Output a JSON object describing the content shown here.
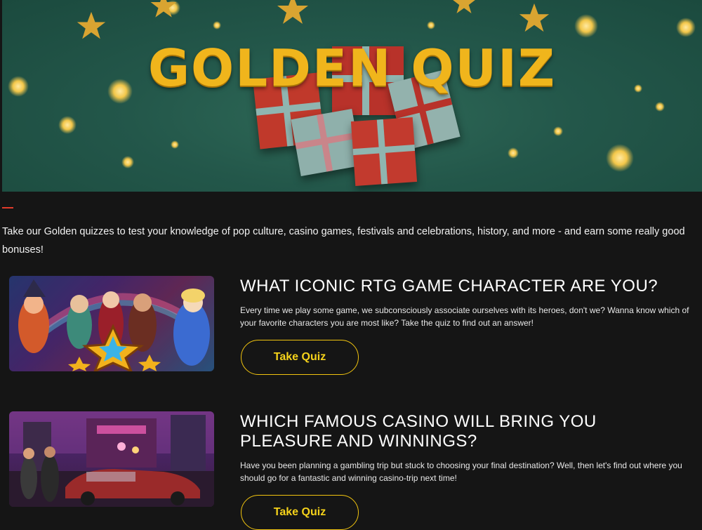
{
  "banner": {
    "title": "GOLDEN QUIZ"
  },
  "intro": "Take our Golden quizzes to test your knowledge of pop culture, casino games, festivals and celebrations, history, and more - and earn some really good bonuses!",
  "quizzes": [
    {
      "title": "WHAT ICONIC RTG GAME CHARACTER ARE YOU?",
      "description": "Every time we play some game, we subconsciously associate ourselves with its heroes, don't we? Wanna know which of your favorite characters you are most like? Take the quiz to find out an answer!",
      "button": "Take Quiz"
    },
    {
      "title": "WHICH FAMOUS CASINO WILL BRING YOU PLEASURE AND WINNINGS?",
      "description": "Have you been planning a gambling trip but stuck to choosing your final destination? Well, then let's find out where you should go for a fantastic and winning casino-trip next time!",
      "button": "Take Quiz"
    }
  ],
  "colors": {
    "accent": "#e23b2a",
    "button_border": "#f1c40f",
    "banner_bg": "#23574a",
    "title_gold": "#f0b51c"
  }
}
